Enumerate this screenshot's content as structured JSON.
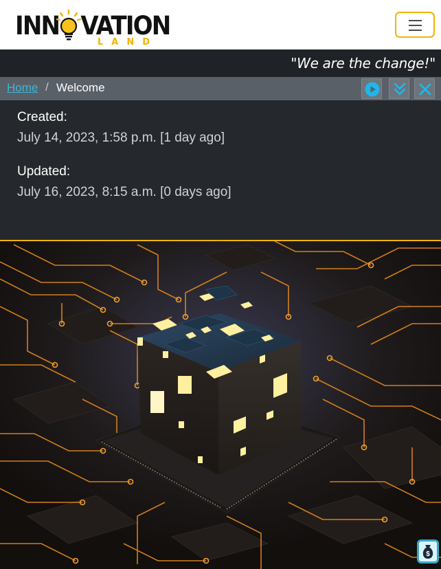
{
  "brand": {
    "logo_main": "INNOVATION",
    "logo_sub": "LAND",
    "accent_color": "#f0b400"
  },
  "navbar": {
    "menu_icon": "hamburger-icon"
  },
  "slogan": "\"We are the change!\"",
  "breadcrumb": {
    "home_label": "Home",
    "separator": "/",
    "current": "Welcome",
    "actions": [
      {
        "icon": "play-circle-icon"
      },
      {
        "icon": "double-chevron-down-icon"
      },
      {
        "icon": "close-icon"
      }
    ]
  },
  "meta": {
    "created_label": "Created:",
    "created_value": "July 14, 2023, 1:58 p.m. [1 day ago]",
    "updated_label": "Updated:",
    "updated_value": "July 16, 2023, 8:15 a.m. [0 days ago]"
  },
  "hero": {
    "image": "glowing-cube-on-circuit-board-image"
  },
  "floating": {
    "icon": "money-bag-icon"
  }
}
